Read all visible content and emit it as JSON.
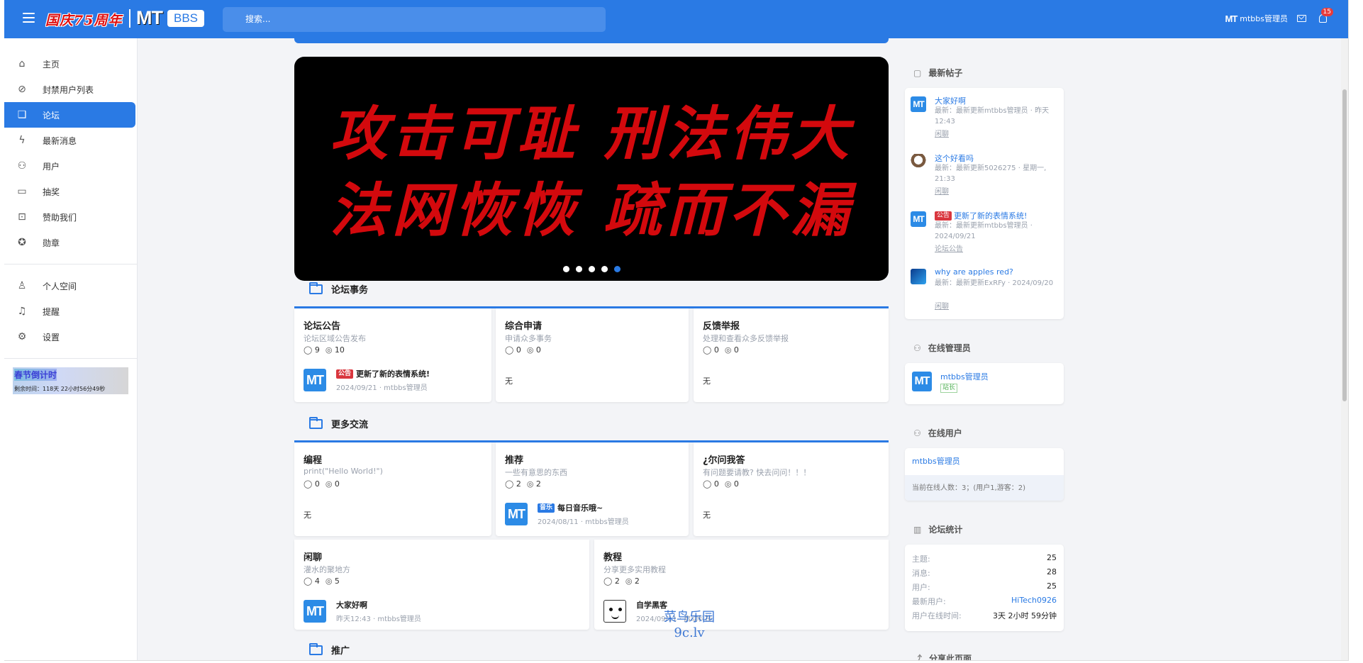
{
  "header": {
    "slogan": "国庆75周年",
    "logo_mt": "MT",
    "logo_bbs": "BBS",
    "search_placeholder": "搜索...",
    "user_logo": "MT",
    "username": "mtbbs管理员",
    "notifications": "15",
    "colors": {
      "bar": "#2a7ae4",
      "slogan": "#e01010"
    }
  },
  "sidebar": {
    "items": [
      {
        "label": "主页",
        "icon": "home-icon"
      },
      {
        "label": "封禁用户列表",
        "icon": "user-ban-icon"
      },
      {
        "label": "论坛",
        "icon": "forum-icon",
        "active": true
      },
      {
        "label": "最新消息",
        "icon": "lightning-icon"
      },
      {
        "label": "用户",
        "icon": "users-icon"
      },
      {
        "label": "抽奖",
        "icon": "folder-icon"
      },
      {
        "label": "赞助我们",
        "icon": "money-icon"
      },
      {
        "label": "勋章",
        "icon": "medal-icon"
      }
    ],
    "items2": [
      {
        "label": "个人空间",
        "icon": "user-icon"
      },
      {
        "label": "提醒",
        "icon": "bell-icon"
      },
      {
        "label": "设置",
        "icon": "gear-icon"
      }
    ],
    "countdown": {
      "title": "春节倒计时",
      "remaining": "剩余时间：118天 22小时56分49秒"
    }
  },
  "banner": {
    "line1": "攻击可耻 刑法伟大",
    "line2": "法网恢恢 疏而不漏",
    "active_dot": 5,
    "dot_count": 5
  },
  "sections": [
    {
      "title": "论坛事务",
      "forums": [
        {
          "name": "论坛公告",
          "desc": "论坛区域公告发布",
          "threads": "9",
          "replies": "10",
          "last": {
            "badge": "公告",
            "title": "更新了新的表情系统!",
            "meta": "2024/09/21 · mtbbs管理员",
            "avatar": "MT"
          }
        },
        {
          "name": "综合申请",
          "desc": "申请众多事务",
          "threads": "0",
          "replies": "0",
          "none": "无"
        },
        {
          "name": "反馈举报",
          "desc": "处理和查看众多反馈举报",
          "threads": "0",
          "replies": "0",
          "none": "无"
        }
      ]
    },
    {
      "title": "更多交流",
      "forums": [
        {
          "name": "编程",
          "desc": "print(\"Hello World!\")",
          "threads": "0",
          "replies": "0",
          "none": "无"
        },
        {
          "name": "推荐",
          "desc": "一些有意思的东西",
          "threads": "2",
          "replies": "2",
          "last": {
            "badge": "音乐",
            "title": "每日音乐哦~",
            "meta": "2024/08/11 · mtbbs管理员",
            "avatar": "MT"
          }
        },
        {
          "name": "¿尔问我答",
          "desc": "有问题要请教? 快去问问！！！",
          "threads": "0",
          "replies": "0",
          "none": "无"
        },
        {
          "name": "闲聊",
          "desc": "灌水的聚地方",
          "threads": "4",
          "replies": "5",
          "last": {
            "title": "大家好啊",
            "meta": "昨天12:43 · mtbbs管理员",
            "avatar": "MT"
          }
        },
        {
          "name": "教程",
          "desc": "分享更多实用教程",
          "threads": "2",
          "replies": "2",
          "last": {
            "title": "自学黑客",
            "meta": "2024/09/11 · 启动科技",
            "avatar": "face"
          }
        }
      ]
    },
    {
      "title": "推广"
    }
  ],
  "right": {
    "latest_title": "最新帖子",
    "posts": [
      {
        "title": "大家好啊",
        "meta": "最新：最新更新mtbbs管理员 · 昨天 12:43",
        "cat": "闲聊",
        "avatar": "MT"
      },
      {
        "title": "这个好看吗",
        "meta": "最新：最新更新5026275 · 星期一, 21:33",
        "cat": "闲聊",
        "avatar": "cat"
      },
      {
        "title": "更新了新的表情系统!",
        "badge": "公告",
        "meta": "最新：最新更新mtbbs管理员 · 2024/09/21",
        "cat": "论坛公告",
        "avatar": "MT"
      },
      {
        "title": "why are apples red?",
        "meta": "最新：最新更新ExRFy · 2024/09/20",
        "cat": "闲聊",
        "avatar": "win"
      }
    ],
    "online_admins_title": "在线管理员",
    "online_admin": {
      "name": "mtbbs管理员",
      "tag": "站长",
      "avatar": "MT"
    },
    "online_users_title": "在线用户",
    "online_user": "mtbbs管理员",
    "online_summary": "当前在线人数：3；(用户1,游客：2)",
    "stats_title": "论坛统计",
    "stats": [
      {
        "k": "主题:",
        "v": "25"
      },
      {
        "k": "消息:",
        "v": "28"
      },
      {
        "k": "用户:",
        "v": "25"
      },
      {
        "k": "最新用户:",
        "v": "HiTech0926",
        "link": true
      },
      {
        "k": "用户在线时间:",
        "v": "3天 2小时 59分钟"
      }
    ],
    "share_title": "分享此页面"
  },
  "watermark": {
    "line1": "菜鸟乐园",
    "line2": "9c.lv"
  }
}
